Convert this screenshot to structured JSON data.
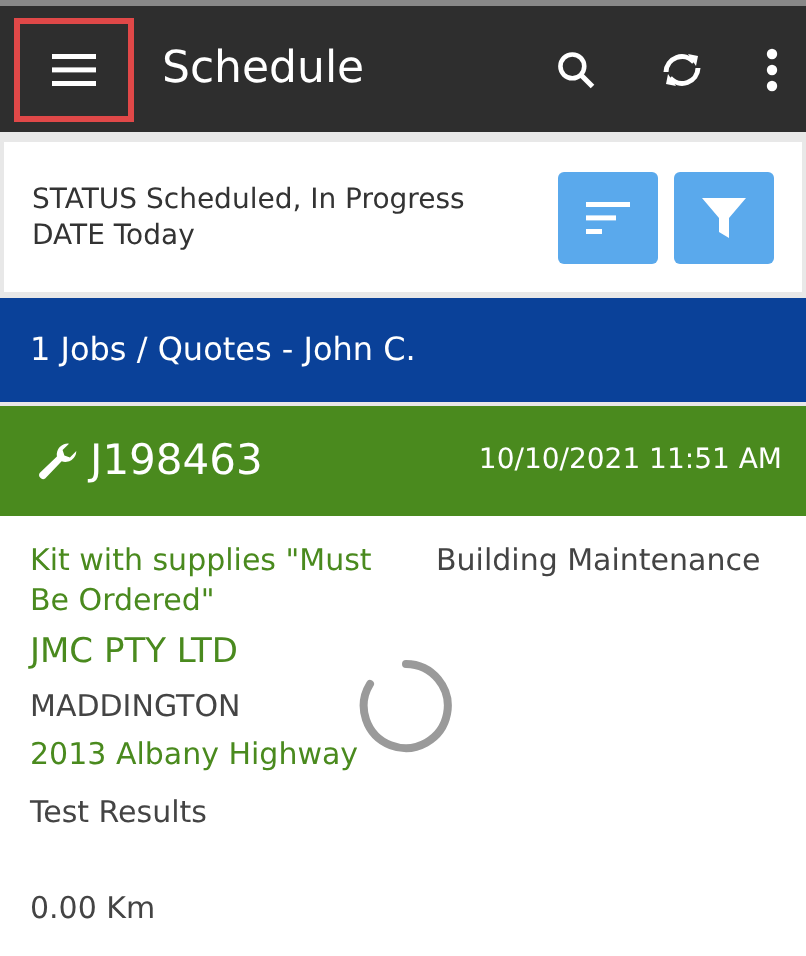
{
  "app_bar": {
    "title": "Schedule",
    "menu_highlighted": true
  },
  "filters": {
    "lines": [
      {
        "label": "STATUS",
        "value": "Scheduled, In Progress"
      },
      {
        "label": "DATE",
        "value": "Today"
      }
    ]
  },
  "summary": "1 Jobs / Quotes - John C.",
  "job": {
    "number": "J198463",
    "datetime": "10/10/2021 11:51 AM",
    "description": "Kit with supplies \"Must Be Ordered\"",
    "category": "Building Maintenance",
    "company": "JMC PTY LTD",
    "suburb": "MADDINGTON",
    "address": "2013 Albany Highway",
    "note": "Test Results",
    "distance": "0.00 Km",
    "loading": true
  }
}
